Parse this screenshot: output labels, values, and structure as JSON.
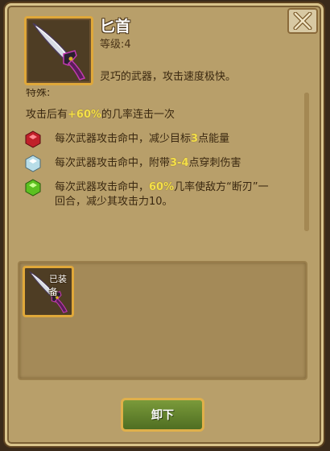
{
  "item": {
    "name": "匕首",
    "level": "等级:4",
    "description": "灵巧的武器，攻击速度极快。",
    "icon": "dagger-icon"
  },
  "special": {
    "label": "特殊:",
    "combo": {
      "prefix": "攻击后有",
      "highlight": "+60%",
      "suffix": "的几率连击一次"
    },
    "effects": [
      {
        "gem": "red-gem-icon",
        "color": "#d8323a",
        "prefix": "每次武器攻击命中，减少目标",
        "highlight": "3",
        "suffix": "点能量",
        "line2": ""
      },
      {
        "gem": "white-gem-icon",
        "color": "#cfe8f0",
        "prefix": "每次武器攻击命中，附带",
        "highlight": "3-4",
        "suffix": "点穿刺伤害",
        "line2": ""
      },
      {
        "gem": "green-gem-icon",
        "color": "#6fd22a",
        "prefix": "每次武器攻击命中，",
        "highlight": "60%",
        "suffix": "几率使敌方“断刃”一",
        "line2": "回合，减少其攻击力10。"
      }
    ]
  },
  "equipped": {
    "badge": "已装备"
  },
  "buttons": {
    "unequip": "卸下",
    "close": "close-icon"
  }
}
